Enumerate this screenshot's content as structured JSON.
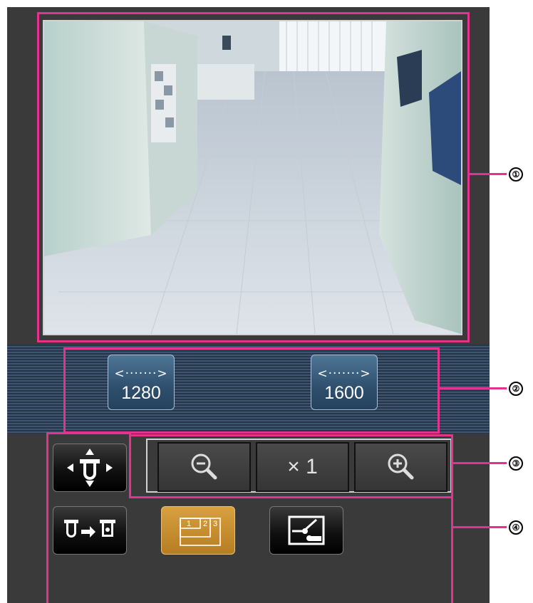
{
  "camera_view": {
    "image": "camera-feed-hallway"
  },
  "resolution": {
    "buttons": [
      {
        "arrow": "<·······>",
        "label": "1280"
      },
      {
        "arrow": "<·······>",
        "label": "1600"
      }
    ]
  },
  "zoom": {
    "reset_label": "× 1"
  },
  "controls": {
    "pan_tilt": "pan-tilt-icon",
    "camera_switch": "camera-switch-icon",
    "multi_screen": "multi-screen-icon",
    "image_adjust": "image-adjust-icon"
  },
  "callouts": [
    "①",
    "②",
    "③",
    "④"
  ],
  "colors": {
    "highlight": "#e5328f",
    "strip": "#2f4560",
    "panel": "#3a3a3a",
    "active": "#c88a2e"
  }
}
